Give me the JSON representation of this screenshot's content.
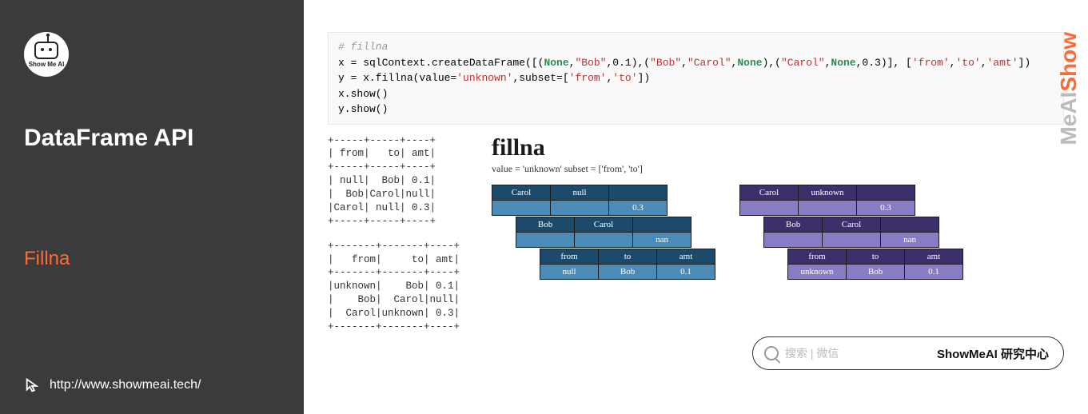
{
  "sidebar": {
    "logo_text": "Show Me AI",
    "title": "DataFrame API",
    "subtitle": "Fillna",
    "url": "http://www.showmeai.tech/"
  },
  "code": {
    "comment": "# fillna",
    "line1_prefix": "x = sqlContext.createDataFrame([(",
    "none": "None",
    "str_bob": "\"Bob\"",
    "str_carol": "\"Carol\"",
    "num01": "0.1",
    "num03": "0.3",
    "cols": "['from','to','amt']",
    "line1_full_plain": "x = sqlContext.createDataFrame([(None,\"Bob\",0.1),(\"Bob\",\"Carol\",None),(\"Carol\",None,0.3)], ['from','to','amt'])",
    "line2_prefix": "y = x.fillna(value=",
    "str_unknown": "'unknown'",
    "line2_mid": ",subset=[",
    "str_from": "'from'",
    "str_to": "'to'",
    "line2_end": "])",
    "line3": "x.show()",
    "line4": "y.show()"
  },
  "ascii_x": "+-----+-----+----+\n| from|   to| amt|\n+-----+-----+----+\n| null|  Bob| 0.1|\n|  Bob|Carol|null|\n|Carol| null| 0.3|\n+-----+-----+----+",
  "ascii_y": "+-------+-------+----+\n|   from|     to| amt|\n+-------+-------+----+\n|unknown|    Bob| 0.1|\n|    Bob|  Carol|null|\n|  Carol|unknown| 0.3|\n+-------+-------+----+",
  "diagram": {
    "title": "fillna",
    "subtitle": "value = 'unknown'   subset = ['from', 'to']",
    "blue": {
      "layers": [
        {
          "header": [
            "Carol",
            "null",
            ""
          ],
          "body": [
            "",
            "",
            "0.3"
          ]
        },
        {
          "header": [
            "Bob",
            "Carol",
            ""
          ],
          "body": [
            "",
            "",
            "nan"
          ]
        },
        {
          "header": [
            "from",
            "to",
            "amt"
          ],
          "body": [
            "null",
            "Bob",
            "0.1"
          ]
        }
      ]
    },
    "purple": {
      "layers": [
        {
          "header": [
            "Carol",
            "unknown",
            ""
          ],
          "body": [
            "",
            "",
            "0.3"
          ]
        },
        {
          "header": [
            "Bob",
            "Carol",
            ""
          ],
          "body": [
            "",
            "",
            "nan"
          ]
        },
        {
          "header": [
            "from",
            "to",
            "amt"
          ],
          "body": [
            "unknown",
            "Bob",
            "0.1"
          ]
        }
      ]
    }
  },
  "search": {
    "placeholder": "搜索 | 微信",
    "text": "ShowMeAI 研究中心"
  },
  "vlogo_a": "Show",
  "vlogo_b": "MeAI"
}
